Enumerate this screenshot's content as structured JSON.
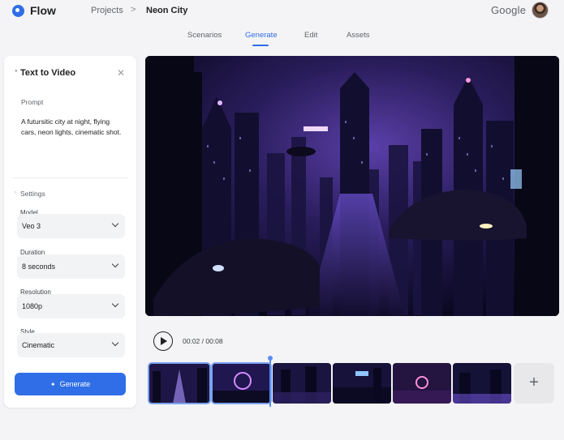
{
  "header": {
    "app_name": "Flow",
    "breadcrumb_projects": "Projects",
    "breadcrumb_separator": ">",
    "breadcrumb_current": "Neon City",
    "brand": "Google"
  },
  "tabs": [
    {
      "label": "Scenarios",
      "active": false
    },
    {
      "label": "Generate",
      "active": true
    },
    {
      "label": "Edit",
      "active": false
    },
    {
      "label": "Assets",
      "active": false
    }
  ],
  "panel": {
    "title": "Text to Video",
    "prompt_label": "Prompt",
    "prompt_text": "A futursitic city at night, flying cars, neon lights, cinematic shot.",
    "settings_label": "Settings",
    "fields": [
      {
        "label": "Model",
        "value": "Veo 3"
      },
      {
        "label": "Duration",
        "value": "8 seconds"
      },
      {
        "label": "Resolution",
        "value": "1080p"
      },
      {
        "label": "Style",
        "value": "Cinematic"
      }
    ],
    "generate_label": "Generate"
  },
  "player": {
    "current_time": "00:02",
    "total_time": "00:08",
    "time_display": "00:02 / 00:08"
  },
  "timeline": {
    "clip_count": 6,
    "selected_clips": [
      0,
      1
    ],
    "add_label": "+"
  },
  "colors": {
    "accent": "#2f6ee6",
    "background": "#f4f4f6",
    "video_tint": "#6a3fd0"
  }
}
